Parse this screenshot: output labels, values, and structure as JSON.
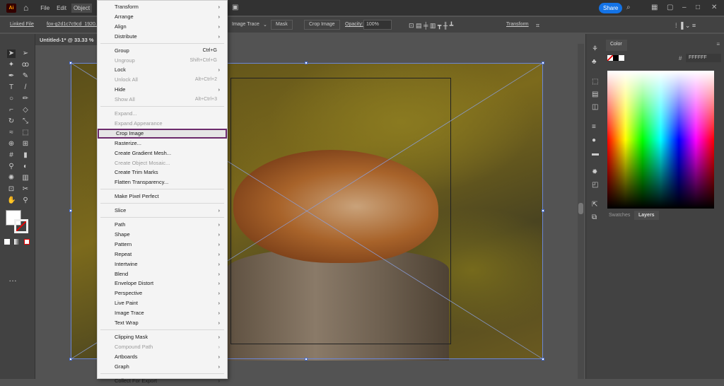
{
  "app": {
    "logo": "Ai",
    "menus": [
      "File",
      "Edit",
      "Object"
    ],
    "share": "Share"
  },
  "control": {
    "linked_file": "Linked File",
    "filename": "fox-g2d1c7c9cd_1920.jpg",
    "image_trace": "Image Trace",
    "mask": "Mask",
    "crop_image": "Crop Image",
    "opacity_label": "Opacity:",
    "opacity_value": "100%",
    "transform": "Transform"
  },
  "document": {
    "tab_title": "Untitled-1* @ 33.33 %"
  },
  "panel": {
    "color_tab": "Color",
    "hex": "FFFFFF",
    "swatches_tab": "Swatches",
    "layers_tab": "Layers"
  },
  "object_menu": [
    {
      "label": "Transform",
      "arrow": true
    },
    {
      "label": "Arrange",
      "arrow": true
    },
    {
      "label": "Align",
      "arrow": true
    },
    {
      "label": "Distribute",
      "arrow": true
    },
    {
      "label": "Group",
      "shortcut": "Ctrl+G",
      "sep": true
    },
    {
      "label": "Ungroup",
      "shortcut": "Shift+Ctrl+G",
      "disabled": true
    },
    {
      "label": "Lock",
      "arrow": true
    },
    {
      "label": "Unlock All",
      "shortcut": "Alt+Ctrl+2",
      "disabled": true
    },
    {
      "label": "Hide",
      "arrow": true
    },
    {
      "label": "Show All",
      "shortcut": "Alt+Ctrl+3",
      "disabled": true
    },
    {
      "label": "Expand...",
      "disabled": true,
      "sep": true
    },
    {
      "label": "Expand Appearance",
      "disabled": true
    },
    {
      "label": "Crop Image",
      "highlighted": true
    },
    {
      "label": "Rasterize..."
    },
    {
      "label": "Create Gradient Mesh..."
    },
    {
      "label": "Create Object Mosaic...",
      "disabled": true
    },
    {
      "label": "Create Trim Marks"
    },
    {
      "label": "Flatten Transparency..."
    },
    {
      "label": "Make Pixel Perfect",
      "sep": true
    },
    {
      "label": "Slice",
      "arrow": true,
      "sep": true
    },
    {
      "label": "Path",
      "arrow": true,
      "sep": true
    },
    {
      "label": "Shape",
      "arrow": true
    },
    {
      "label": "Pattern",
      "arrow": true
    },
    {
      "label": "Repeat",
      "arrow": true
    },
    {
      "label": "Intertwine",
      "arrow": true
    },
    {
      "label": "Blend",
      "arrow": true
    },
    {
      "label": "Envelope Distort",
      "arrow": true
    },
    {
      "label": "Perspective",
      "arrow": true
    },
    {
      "label": "Live Paint",
      "arrow": true
    },
    {
      "label": "Image Trace",
      "arrow": true
    },
    {
      "label": "Text Wrap",
      "arrow": true
    },
    {
      "label": "Clipping Mask",
      "arrow": true,
      "sep": true
    },
    {
      "label": "Compound Path",
      "arrow": true,
      "disabled": true
    },
    {
      "label": "Artboards",
      "arrow": true
    },
    {
      "label": "Graph",
      "arrow": true
    },
    {
      "label": "Collect For Export",
      "arrow": true,
      "sep": true
    }
  ]
}
